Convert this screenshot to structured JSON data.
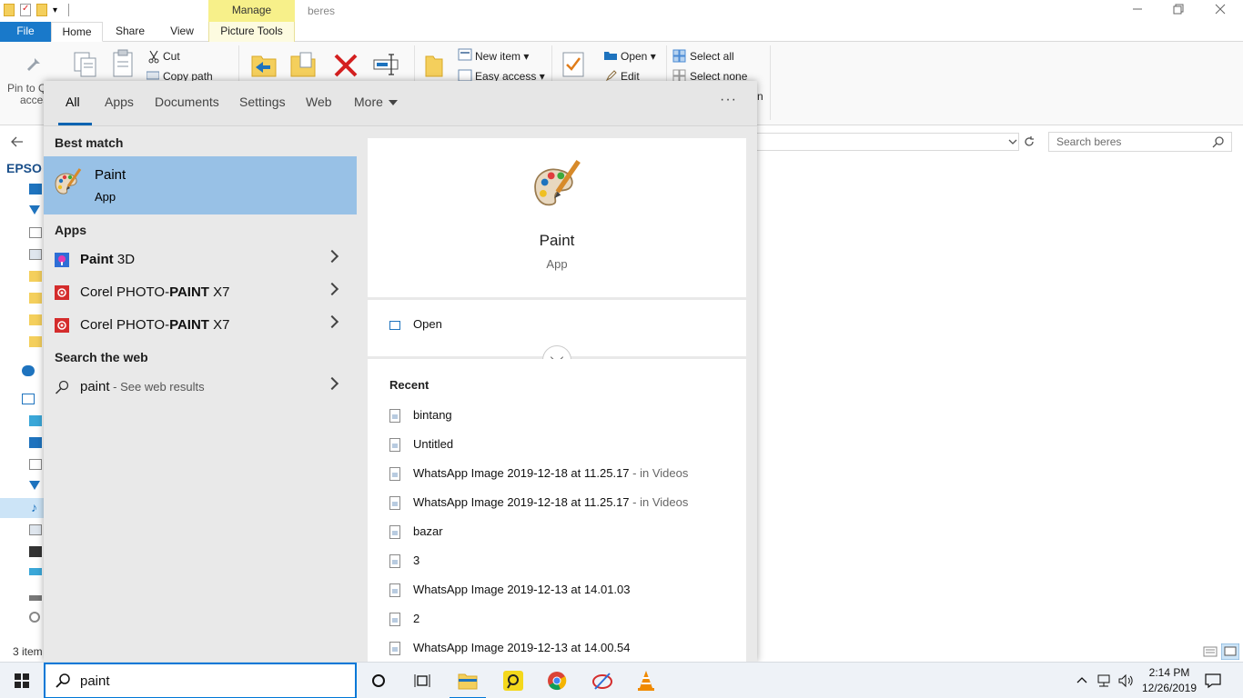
{
  "explorer": {
    "title": "beres",
    "manage_tab": "Manage",
    "tabs": {
      "file": "File",
      "home": "Home",
      "share": "Share",
      "view": "View",
      "picture_tools": "Picture Tools"
    },
    "ribbon": {
      "pin_line1": "Pin to Q",
      "pin_line2": "acces",
      "cut": "Cut",
      "copy_path": "Copy path",
      "new_item": "New item",
      "easy_access": "Easy access",
      "open": "Open",
      "edit": "Edit",
      "select_all": "Select all",
      "select_none": "Select none",
      "partial_h": "n"
    },
    "search_placeholder": "Search beres",
    "nav_partial": "EPSO",
    "status_text": "3 item"
  },
  "search_panel": {
    "tabs": [
      {
        "label": "All"
      },
      {
        "label": "Apps"
      },
      {
        "label": "Documents"
      },
      {
        "label": "Settings"
      },
      {
        "label": "Web"
      },
      {
        "label": "More"
      }
    ],
    "more_options": "···",
    "best_match_header": "Best match",
    "best_match": {
      "name": "Paint",
      "type": "App"
    },
    "apps_header": "Apps",
    "apps": [
      {
        "prefix": "Paint ",
        "suffix": "3D",
        "bold_part": "Paint",
        "icon": "paint-3d-icon"
      },
      {
        "prefix": "Corel PHOTO-",
        "bold_part": "PAINT",
        "suffix": " X7",
        "icon": "corel-photo-paint-icon"
      },
      {
        "prefix": "Corel PHOTO-",
        "bold_part": "PAINT",
        "suffix": " X7",
        "icon": "corel-photo-paint-icon"
      }
    ],
    "web_header": "Search the web",
    "web": {
      "query": "paint",
      "suffix": " - See web results"
    },
    "detail": {
      "name": "Paint",
      "type": "App",
      "open_label": "Open",
      "recent_header": "Recent",
      "recent": [
        {
          "name": "bintang",
          "loc": ""
        },
        {
          "name": "Untitled",
          "loc": ""
        },
        {
          "name": "WhatsApp Image 2019-12-18 at 11.25.17",
          "loc": " - in Videos"
        },
        {
          "name": "WhatsApp Image 2019-12-18 at 11.25.17",
          "loc": " - in Videos"
        },
        {
          "name": "bazar",
          "loc": ""
        },
        {
          "name": "3",
          "loc": ""
        },
        {
          "name": "WhatsApp Image 2019-12-13 at 14.01.03",
          "loc": ""
        },
        {
          "name": "2",
          "loc": ""
        },
        {
          "name": "WhatsApp Image 2019-12-13 at 14.00.54",
          "loc": ""
        }
      ]
    }
  },
  "taskbar": {
    "search_text": "paint",
    "time": "2:14 PM",
    "date": "12/26/2019",
    "apps": [
      "cortana-icon",
      "task-view-icon",
      "file-explorer-icon",
      "app-yellow-icon",
      "chrome-icon",
      "coreldraw-icon",
      "vlc-icon"
    ]
  },
  "colors": {
    "accent": "#0078d7",
    "best_match_bg": "#98c1e6",
    "file_tab": "#1979ca",
    "manage_tab": "#f7f08a"
  }
}
